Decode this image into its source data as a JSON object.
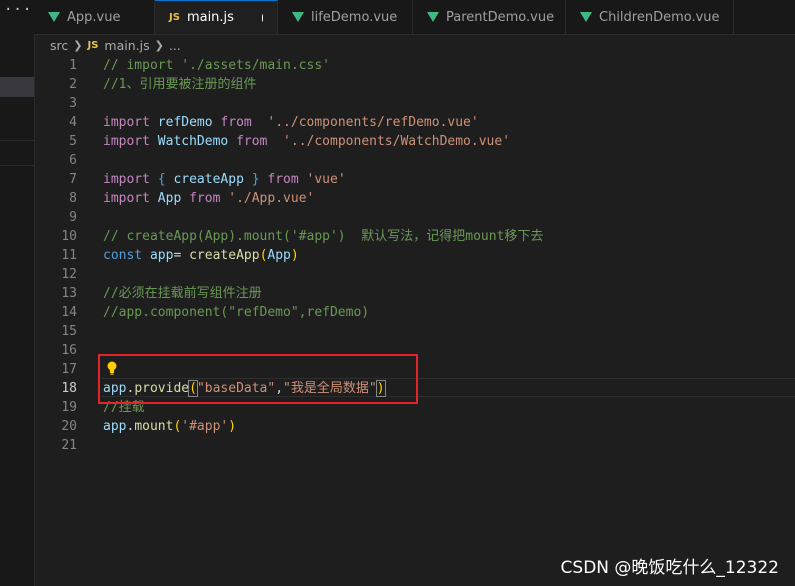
{
  "sidebar": {
    "more_label": "···"
  },
  "tabs": [
    {
      "label": "App.vue",
      "icon": "vue-icon"
    },
    {
      "label": "main.js",
      "icon": "js-icon",
      "active": true,
      "unsaved": true
    },
    {
      "label": "lifeDemo.vue",
      "icon": "vue-icon"
    },
    {
      "label": "ParentDemo.vue",
      "icon": "vue-icon"
    },
    {
      "label": "ChildrenDemo.vue",
      "icon": "vue-icon"
    }
  ],
  "js_badge": "JS",
  "breadcrumb": {
    "folder": "src",
    "file": "main.js",
    "more": "..."
  },
  "editor": {
    "current_line": 18,
    "line_numbers": [
      "1",
      "2",
      "3",
      "4",
      "5",
      "6",
      "7",
      "8",
      "9",
      "10",
      "11",
      "12",
      "13",
      "14",
      "15",
      "16",
      "17",
      "18",
      "19",
      "20",
      "21"
    ],
    "lines": {
      "l1": "// import './assets/main.css'",
      "l2": "//1、引用要被注册的组件",
      "l4_import": "import",
      "l4_name": "refDemo",
      "l4_from": "from",
      "l4_path": "'../components/refDemo.vue'",
      "l5_import": "import",
      "l5_name": "WatchDemo",
      "l5_from": "from",
      "l5_path": "'../components/WatchDemo.vue'",
      "l7_import": "import",
      "l7_open": "{",
      "l7_name": "createApp",
      "l7_close": "}",
      "l7_from": "from",
      "l7_path": "'vue'",
      "l8_import": "import",
      "l8_name": "App",
      "l8_from": "from",
      "l8_path": "'./App.vue'",
      "l10": "// createApp(App).mount('#app')  默认写法，记得把mount移下去",
      "l11_const": "const",
      "l11_var": "app",
      "l11_eq": "=",
      "l11_fn": "createApp",
      "l11_open": "(",
      "l11_arg": "App",
      "l11_close": ")",
      "l13": "//必须在挂载前写组件注册",
      "l14": "//app.component(\"refDemo\",refDemo)",
      "l18_obj": "app",
      "l18_dot": ".",
      "l18_fn": "provide",
      "l18_open": "(",
      "l18_arg1": "\"baseData\"",
      "l18_comma": ",",
      "l18_arg2": "\"我是全局数据\"",
      "l18_close": ")",
      "l19": "//挂载",
      "l20_obj": "app",
      "l20_dot": ".",
      "l20_fn": "mount",
      "l20_open": "(",
      "l20_arg": "'#app'",
      "l20_close": ")"
    }
  },
  "watermark": "CSDN @晚饭吃什么_12322"
}
